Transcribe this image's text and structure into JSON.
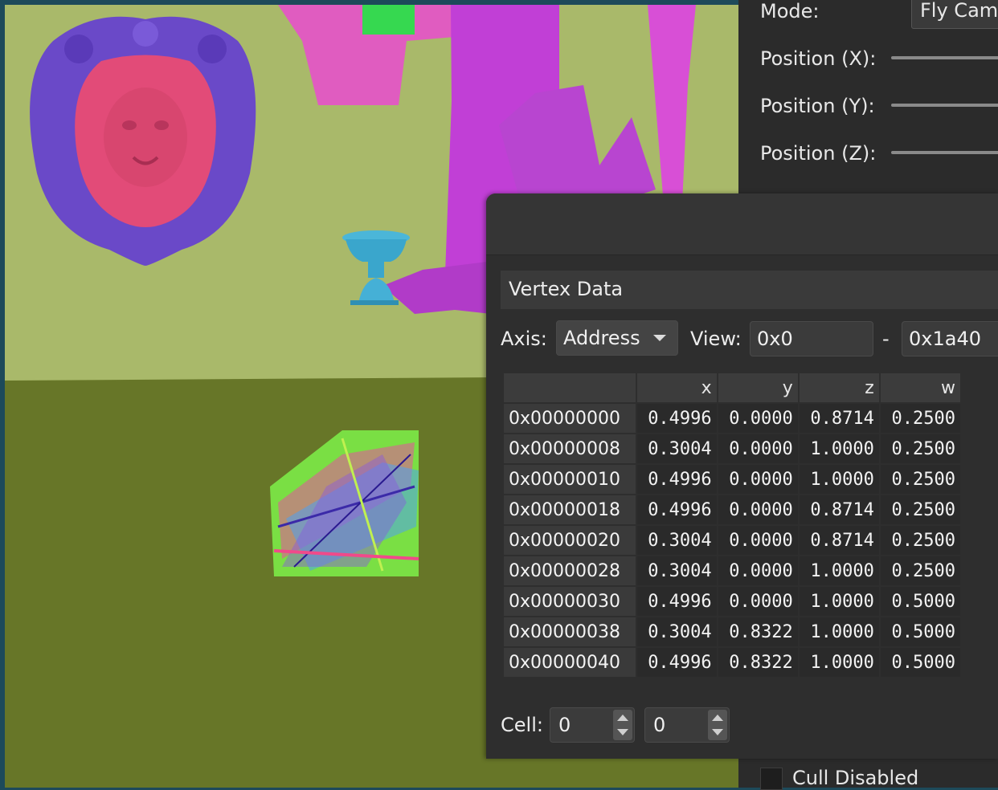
{
  "side_panel": {
    "mode_label": "Mode:",
    "mode_value": "Fly Camera",
    "position_x_label": "Position (X):",
    "position_y_label": "Position (Y):",
    "position_z_label": "Position (Z):",
    "cull_label": "Cull Disabled"
  },
  "vertex_window": {
    "header": "Vertex Data",
    "axis_label": "Axis:",
    "axis_value": "Address",
    "view_label": "View:",
    "view_start": "0x0",
    "view_sep": "-",
    "view_end": "0x1a40",
    "columns": [
      "x",
      "y",
      "z",
      "w"
    ],
    "rows": [
      {
        "addr": "0x00000000",
        "x": "0.4996",
        "y": "0.0000",
        "z": "0.8714",
        "w": "0.2500"
      },
      {
        "addr": "0x00000008",
        "x": "0.3004",
        "y": "0.0000",
        "z": "1.0000",
        "w": "0.2500"
      },
      {
        "addr": "0x00000010",
        "x": "0.4996",
        "y": "0.0000",
        "z": "1.0000",
        "w": "0.2500"
      },
      {
        "addr": "0x00000018",
        "x": "0.4996",
        "y": "0.0000",
        "z": "0.8714",
        "w": "0.2500"
      },
      {
        "addr": "0x00000020",
        "x": "0.3004",
        "y": "0.0000",
        "z": "0.8714",
        "w": "0.2500"
      },
      {
        "addr": "0x00000028",
        "x": "0.3004",
        "y": "0.0000",
        "z": "1.0000",
        "w": "0.2500"
      },
      {
        "addr": "0x00000030",
        "x": "0.4996",
        "y": "0.0000",
        "z": "1.0000",
        "w": "0.5000"
      },
      {
        "addr": "0x00000038",
        "x": "0.3004",
        "y": "0.8322",
        "z": "1.0000",
        "w": "0.5000"
      },
      {
        "addr": "0x00000040",
        "x": "0.4996",
        "y": "0.8322",
        "z": "1.0000",
        "w": "0.5000"
      }
    ],
    "cell_label": "Cell:",
    "cell_row": "0",
    "cell_col": "0"
  },
  "colors": {
    "wall": "#a9b96a",
    "floor": "#677628",
    "shield": "#6a49c8",
    "lion": "#e24b78",
    "magenta": "#d84fd6",
    "pink": "#e05cc0",
    "vase": "#4bb6d8"
  }
}
